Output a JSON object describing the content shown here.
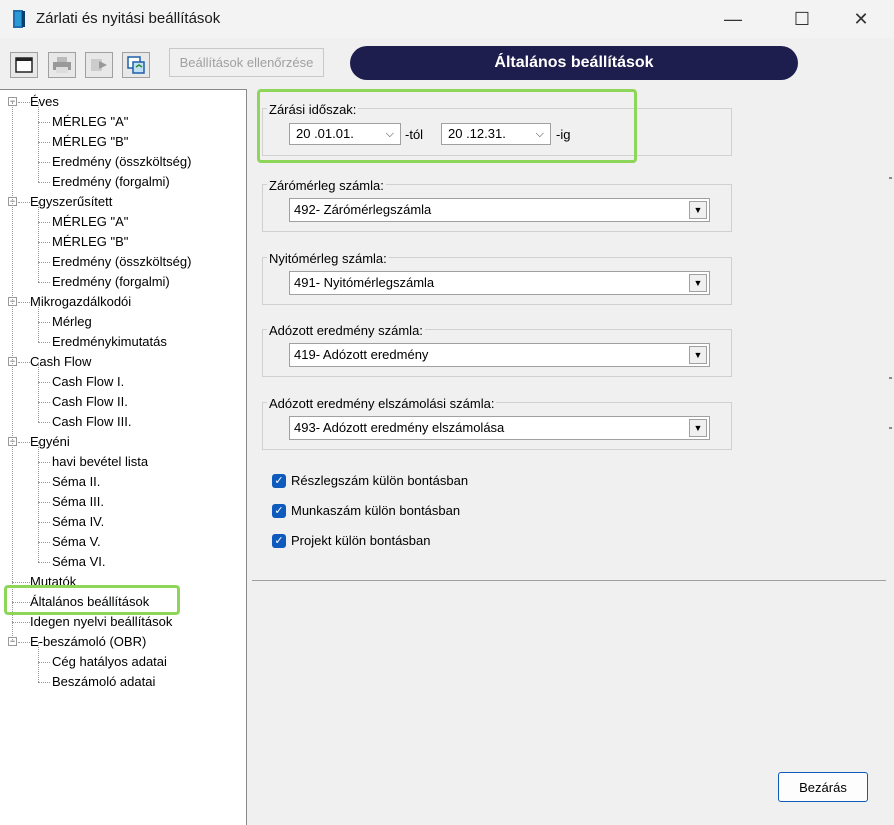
{
  "window": {
    "title": "Zárlati és nyitási beállítások",
    "minimize": "—",
    "maximize": "☐",
    "close": "✕"
  },
  "toolbar": {
    "check_settings_label": "Beállítások ellenőrzése",
    "header_title": "Általános beállítások"
  },
  "tree": {
    "groups": [
      {
        "label": "Éves",
        "children": [
          "MÉRLEG \"A\"",
          "MÉRLEG \"B\"",
          "Eredmény (összköltség)",
          "Eredmény (forgalmi)"
        ]
      },
      {
        "label": "Egyszerűsített",
        "children": [
          "MÉRLEG \"A\"",
          "MÉRLEG \"B\"",
          "Eredmény (összköltség)",
          "Eredmény (forgalmi)"
        ]
      },
      {
        "label": "Mikrogazdálkodói",
        "children": [
          "Mérleg",
          "Eredménykimutatás"
        ]
      },
      {
        "label": "Cash Flow",
        "children": [
          "Cash Flow I.",
          "Cash Flow II.",
          "Cash Flow III."
        ]
      },
      {
        "label": "Egyéni",
        "children": [
          "havi bevétel lista",
          "Séma II.",
          "Séma III.",
          "Séma IV.",
          "Séma V.",
          "Séma VI."
        ]
      }
    ],
    "leaf_mutatok": "Mutatók",
    "leaf_altalanos": "Általános beállítások",
    "leaf_idegen": "Idegen nyelvi beállítások",
    "ebeszamolo": {
      "label": "E-beszámoló (OBR)",
      "children": [
        "Cég hatályos adatai",
        "Beszámoló adatai"
      ]
    },
    "expander_symbol": "−"
  },
  "main": {
    "period": {
      "label": "Zárási időszak:",
      "from_value": "20   .01.01.",
      "from_suffix": "-tól",
      "to_value": "20   .12.31.",
      "to_suffix": "-ig",
      "chevron": "⌵"
    },
    "closing_account": {
      "label": "Zárómérleg számla:",
      "value": "492- Zárómérlegszámla"
    },
    "opening_account": {
      "label": "Nyitómérleg számla:",
      "value": "491- Nyitómérlegszámla"
    },
    "taxed_result_account": {
      "label": "Adózott eredmény számla:",
      "value": "419- Adózott eredmény"
    },
    "taxed_result_settlement_account": {
      "label": "Adózott eredmény elszámolási számla:",
      "value": "493- Adózott eredmény elszámolása"
    },
    "combo_arrow": "▼",
    "checkboxes": [
      {
        "label": "Részlegszám külön bontásban",
        "checked": true
      },
      {
        "label": "Munkaszám külön bontásban",
        "checked": true
      },
      {
        "label": "Projekt külön bontásban",
        "checked": true
      }
    ],
    "check_mark": "✓",
    "close_button": "Bezárás"
  }
}
